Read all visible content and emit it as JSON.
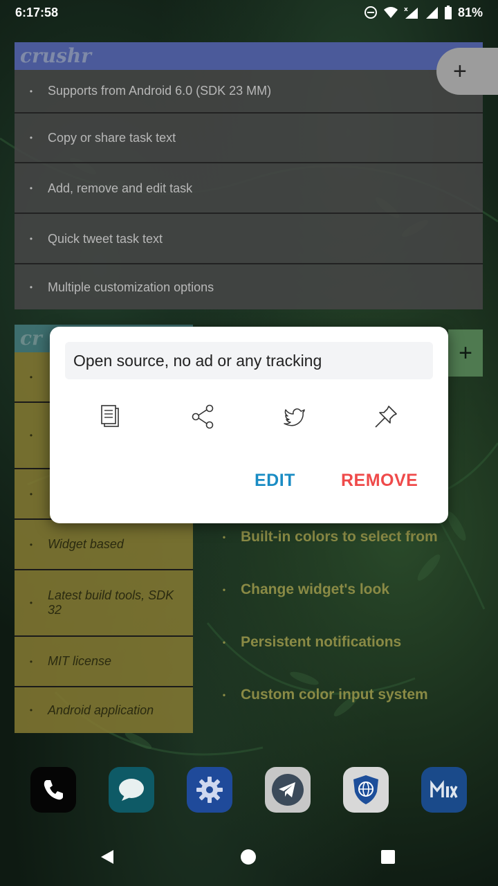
{
  "status_bar": {
    "time": "6:17:58",
    "battery": "81%"
  },
  "widget1": {
    "title": "crushr",
    "items": [
      {
        "text": "Supports from Android 6.0 (SDK 23 MM)"
      },
      {
        "text": "Copy or share task text"
      },
      {
        "text": "Add, remove and edit task"
      },
      {
        "text": "Quick tweet task text"
      },
      {
        "text": "Multiple customization options"
      }
    ],
    "add_label": "+"
  },
  "widget2": {
    "title": "cr",
    "items": [
      {
        "text": "Widget based"
      },
      {
        "text": "Latest build tools, SDK 32"
      },
      {
        "text": "MIT license"
      },
      {
        "text": "Android application"
      }
    ],
    "add_label": "+"
  },
  "widget3": {
    "items": [
      {
        "text": "Built-in colors to select from"
      },
      {
        "text": "Change widget's look"
      },
      {
        "text": "Persistent notifications"
      },
      {
        "text": "Custom color input system"
      }
    ]
  },
  "dialog": {
    "task_text": "Open source, no ad or any tracking",
    "edit_label": "EDIT",
    "remove_label": "REMOVE",
    "icons": [
      "copy-icon",
      "share-icon",
      "twitter-icon",
      "pin-icon"
    ]
  },
  "dock": {
    "apps": [
      "phone-icon",
      "messages-icon",
      "settings-icon",
      "telegram-icon",
      "browser-shield-icon",
      "mix-icon"
    ]
  },
  "colors": {
    "widget1_header": "#4b5a9a",
    "widget2_header": "#3d6e6e",
    "widget2_bg": "#827832",
    "edit": "#1a8cc4",
    "remove": "#ef4a4a"
  }
}
